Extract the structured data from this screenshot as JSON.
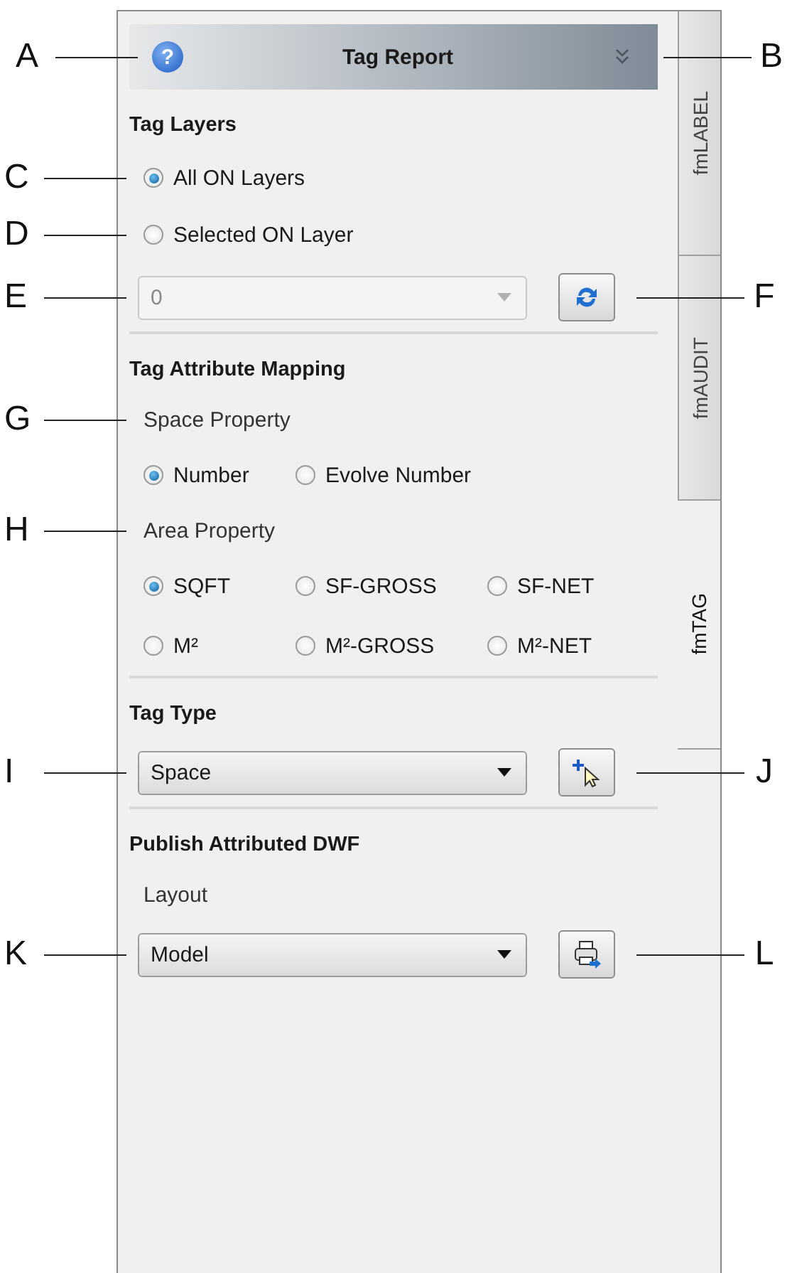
{
  "header": {
    "help_glyph": "?",
    "title": "Tag Report",
    "callout_left": "A",
    "callout_right": "B"
  },
  "tabs": [
    {
      "label": "fmLABEL",
      "selected": false
    },
    {
      "label": "fmAUDIT",
      "selected": false
    },
    {
      "label": "fmTAG",
      "selected": true
    }
  ],
  "sections": [
    {
      "title": "Tag Layers",
      "rows": [
        {
          "kind": "radio",
          "callout": "C",
          "options": [
            {
              "label": "All ON Layers",
              "selected": true
            }
          ]
        },
        {
          "kind": "radio",
          "callout": "D",
          "options": [
            {
              "label": "Selected ON Layer",
              "selected": false
            }
          ]
        },
        {
          "kind": "combo",
          "value": "0",
          "disabled": true,
          "callout": "E",
          "button": {
            "kind": "refresh",
            "callout": "F"
          }
        }
      ]
    },
    {
      "title": "Tag Attribute Mapping",
      "rows": [
        {
          "kind": "label",
          "text": "Space Property",
          "callout": "G"
        },
        {
          "kind": "radio",
          "options": [
            {
              "label": "Number",
              "selected": true
            },
            {
              "label": "Evolve Number",
              "selected": false
            }
          ]
        },
        {
          "kind": "label",
          "text": "Area Property",
          "callout": "H"
        },
        {
          "kind": "radio",
          "options": [
            {
              "label": "SQFT",
              "selected": true
            },
            {
              "label": "SF-GROSS",
              "selected": false
            },
            {
              "label": "SF-NET",
              "selected": false
            },
            {
              "label": "M²",
              "selected": false
            },
            {
              "label": "M²-GROSS",
              "selected": false
            },
            {
              "label": "M²-NET",
              "selected": false
            }
          ]
        }
      ]
    },
    {
      "title": "Tag Type",
      "rows": [
        {
          "kind": "combo",
          "value": "Space",
          "disabled": false,
          "callout": "I",
          "button": {
            "kind": "pick",
            "callout": "J"
          }
        }
      ]
    },
    {
      "title": "Publish Attributed DWF",
      "rows": [
        {
          "kind": "label",
          "text": "Layout"
        },
        {
          "kind": "combo",
          "value": "Model",
          "disabled": false,
          "callout": "K",
          "button": {
            "kind": "publish",
            "callout": "L"
          }
        }
      ]
    }
  ]
}
